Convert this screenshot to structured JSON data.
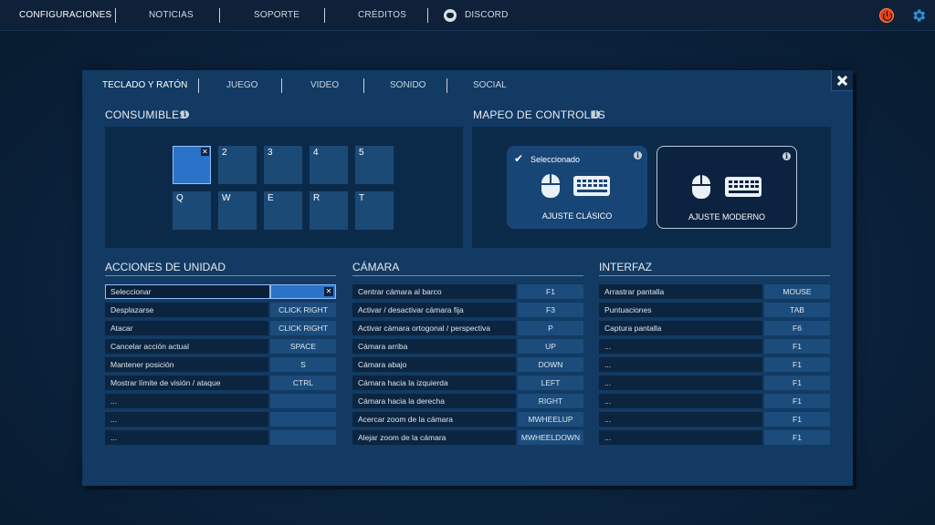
{
  "topbar": {
    "items": [
      {
        "label": "CONFIGURACIONES"
      },
      {
        "label": "NOTICIAS"
      },
      {
        "label": "SOPORTE"
      },
      {
        "label": "CRÉDITOS"
      },
      {
        "label": "DISCORD"
      }
    ],
    "icons": [
      "discord-icon",
      "power-icon",
      "gear-icon"
    ]
  },
  "tabs": [
    {
      "label": "TECLADO Y RATÓN",
      "active": true
    },
    {
      "label": "JUEGO"
    },
    {
      "label": "VIDEO"
    },
    {
      "label": "SONIDO"
    },
    {
      "label": "SOCIAL"
    }
  ],
  "consumables": {
    "title": "CONSUMIBLES",
    "slots": [
      "",
      "2",
      "3",
      "4",
      "5",
      "Q",
      "W",
      "E",
      "R",
      "T"
    ]
  },
  "control_mapping": {
    "title": "MAPEO DE CONTROLES",
    "classic": {
      "label": "AJUSTE CLÁSICO",
      "selected_text": "Seleccionado"
    },
    "modern": {
      "label": "AJUSTE MODERNO"
    }
  },
  "unit_actions": {
    "title": "ACCIONES DE UNIDAD",
    "rows": [
      {
        "action": "Seleccionar",
        "key": ""
      },
      {
        "action": "Desplazarse",
        "key": "CLICK RIGHT"
      },
      {
        "action": "Atacar",
        "key": "CLICK RIGHT"
      },
      {
        "action": "Cancelar acción actual",
        "key": "SPACE"
      },
      {
        "action": "Mantener posición",
        "key": "S"
      },
      {
        "action": "Mostrar límite de visión / ataque",
        "key": "CTRL"
      },
      {
        "action": "...",
        "key": ""
      },
      {
        "action": "...",
        "key": ""
      },
      {
        "action": "...",
        "key": ""
      }
    ]
  },
  "camera": {
    "title": "CÁMARA",
    "rows": [
      {
        "action": "Centrar cámara al barco",
        "key": "F1"
      },
      {
        "action": "Activar / desactivar cámara fija",
        "key": "F3"
      },
      {
        "action": "Activar cámara ortogonal / perspectiva",
        "key": "P"
      },
      {
        "action": "Cámara arriba",
        "key": "UP"
      },
      {
        "action": "Cámara abajo",
        "key": "DOWN"
      },
      {
        "action": "Cámara hacia la izquierda",
        "key": "LEFT"
      },
      {
        "action": "Cámara hacia la derecha",
        "key": "RIGHT"
      },
      {
        "action": "Acercar zoom de la cámara",
        "key": "MWHEELUP"
      },
      {
        "action": "Alejar zoom de la cámara",
        "key": "MWHEELDOWN"
      }
    ]
  },
  "interface": {
    "title": "INTERFAZ",
    "rows": [
      {
        "action": "Arrastrar pantalla",
        "key": "MOUSE"
      },
      {
        "action": "Puntuaciones",
        "key": "TAB"
      },
      {
        "action": "Captura pantalla",
        "key": "F6"
      },
      {
        "action": "...",
        "key": "F1"
      },
      {
        "action": "...",
        "key": "F1"
      },
      {
        "action": "...",
        "key": "F1"
      },
      {
        "action": "...",
        "key": "F1"
      },
      {
        "action": "...",
        "key": "F1"
      },
      {
        "action": "...",
        "key": "F1"
      }
    ]
  },
  "colors": {
    "accent": "#2a73c8",
    "modal_bg": "#123a62",
    "panel_bg": "#0b2a4a",
    "power": "#e0401f",
    "gear": "#2f8fd8"
  }
}
